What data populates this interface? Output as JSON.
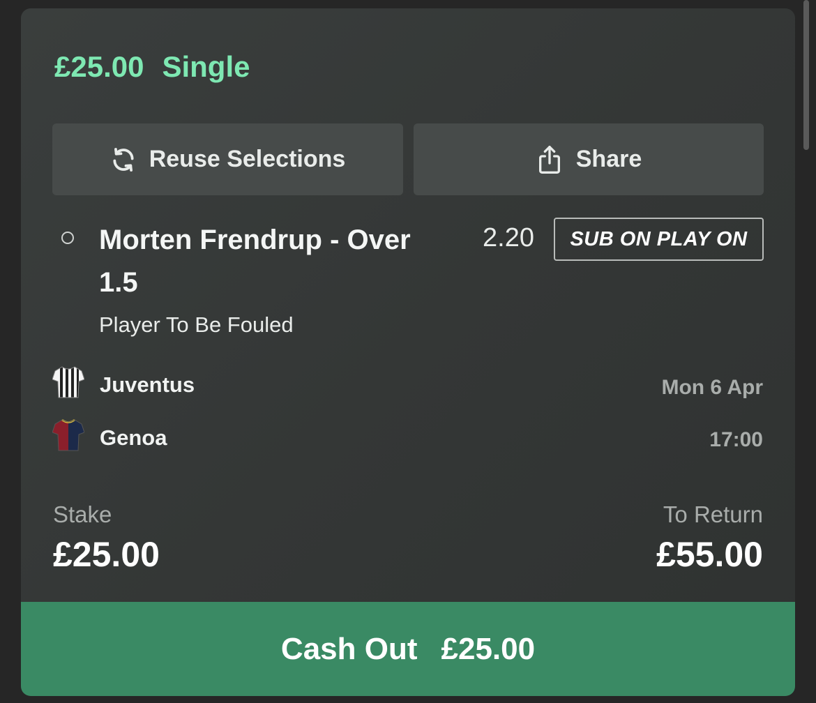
{
  "bet": {
    "amount": "£25.00",
    "type": "Single"
  },
  "actions": {
    "reuse_label": "Reuse Selections",
    "reuse_icon": "refresh-icon",
    "share_label": "Share",
    "share_icon": "share-icon"
  },
  "selection": {
    "name": "Morten Frendrup - Over 1.5",
    "odds": "2.20",
    "badge": "SUB ON PLAY ON",
    "market": "Player To Be Fouled"
  },
  "match": {
    "home_team": "Juventus",
    "away_team": "Genoa",
    "date": "Mon 6 Apr",
    "time": "17:00"
  },
  "totals": {
    "stake_label": "Stake",
    "stake_value": "£25.00",
    "return_label": "To Return",
    "return_value": "£55.00"
  },
  "cashout": {
    "label": "Cash Out",
    "amount": "£25.00"
  },
  "colors": {
    "accent_green": "#7ee8b2",
    "cashout_green": "#3a8a64"
  }
}
